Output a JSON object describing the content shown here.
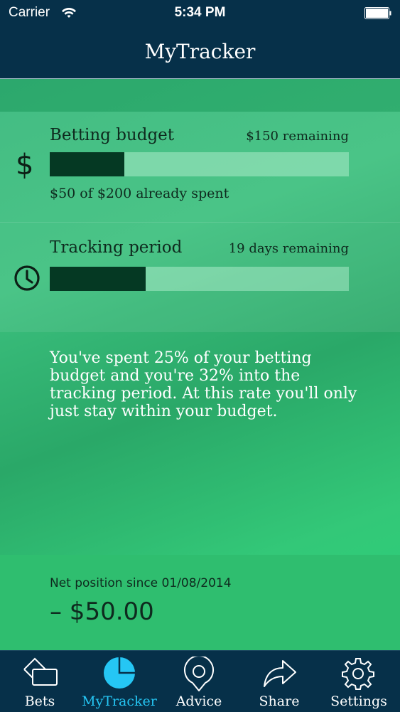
{
  "status_bar": {
    "carrier": "Carrier",
    "time": "5:34 PM"
  },
  "nav": {
    "title": "MyTracker"
  },
  "budget": {
    "label": "Betting budget",
    "remaining": "$150 remaining",
    "spent_text": "$50 of $200 already spent",
    "progress_fraction": 0.25,
    "icon": "dollar-icon"
  },
  "period": {
    "label": "Tracking period",
    "remaining": "19 days remaining",
    "progress_fraction": 0.32,
    "icon": "clock-icon"
  },
  "message": "You've spent 25% of your betting budget and you're 32% into the tracking period. At this rate you'll only just stay within your budget.",
  "net": {
    "label": "Net position since 01/08/2014",
    "value": "– $50.00"
  },
  "tabs": [
    {
      "label": "Bets",
      "icon": "ticket-icon",
      "active": false
    },
    {
      "label": "MyTracker",
      "icon": "pie-chart-icon",
      "active": true
    },
    {
      "label": "Advice",
      "icon": "location-pin-icon",
      "active": false
    },
    {
      "label": "Share",
      "icon": "share-arrow-icon",
      "active": false
    },
    {
      "label": "Settings",
      "icon": "gear-icon",
      "active": false
    }
  ],
  "colors": {
    "nav_bg": "#063049",
    "accent_active": "#25c6f4",
    "bar_fill": "#053923",
    "content_green": "#2fbf78"
  }
}
